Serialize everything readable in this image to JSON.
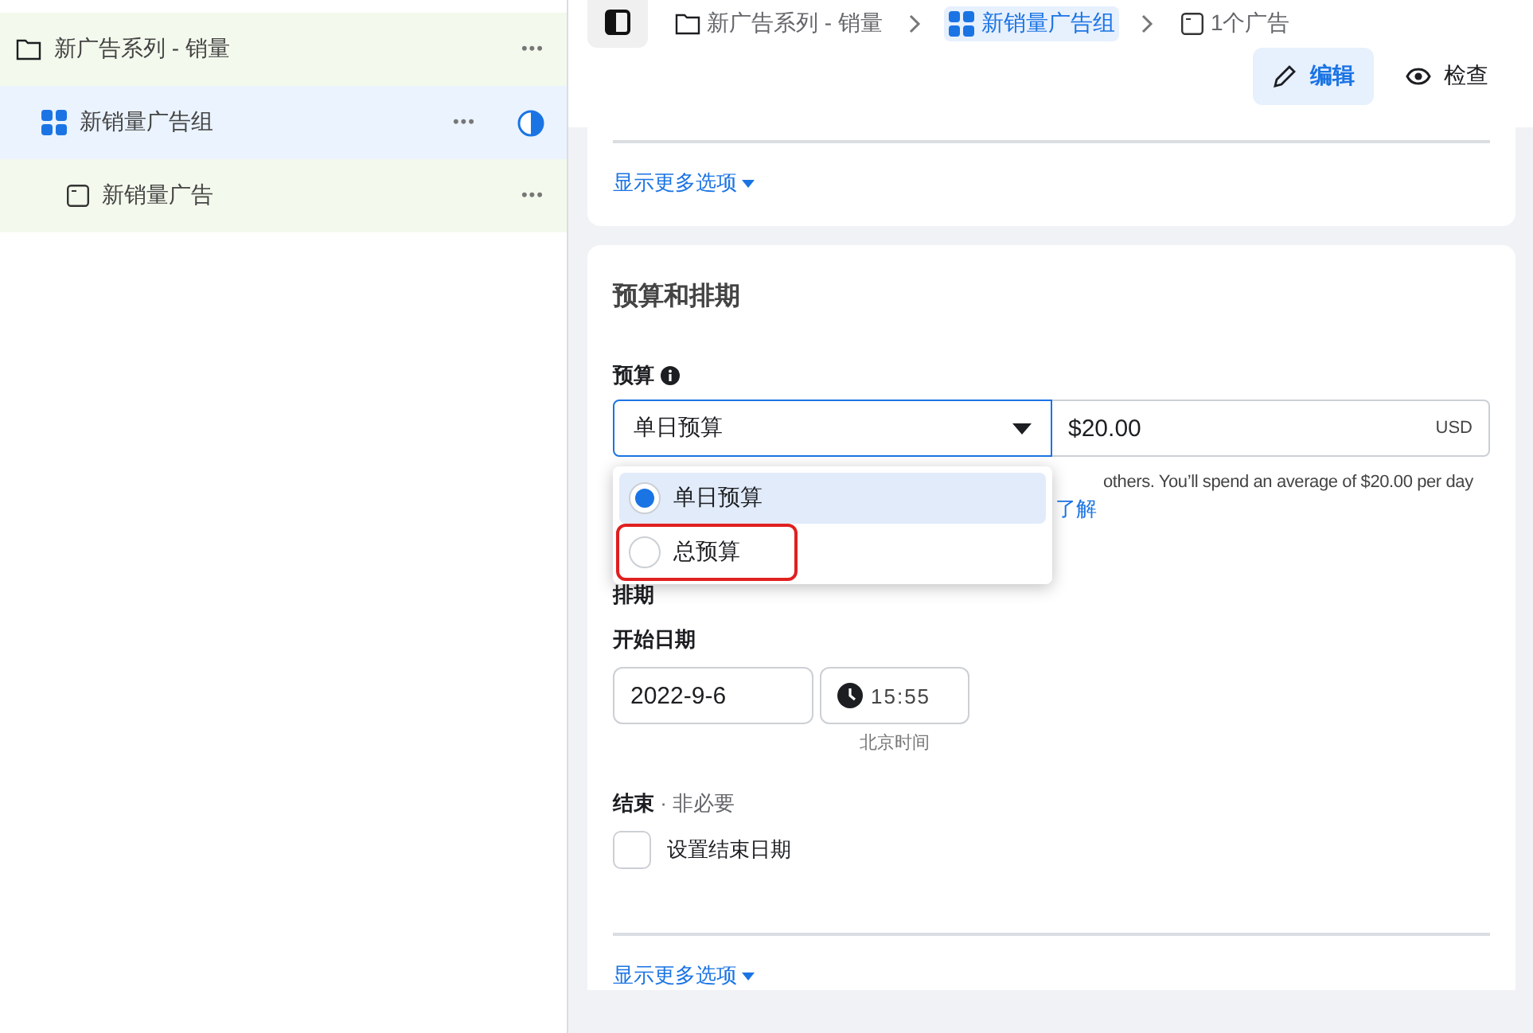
{
  "sidebar": {
    "items": [
      {
        "kind": "campaign",
        "label": "新广告系列 - 销量",
        "selected": false,
        "more": "•••",
        "status": false
      },
      {
        "kind": "adset",
        "label": "新销量广告组",
        "selected": true,
        "more": "•••",
        "status": true
      },
      {
        "kind": "ad",
        "label": "新销量广告",
        "selected": false,
        "more": "•••",
        "status": false
      }
    ]
  },
  "breadcrumb": [
    {
      "kind": "campaign",
      "label": "新广告系列 - 销量",
      "selected": false
    },
    {
      "kind": "adset",
      "label": "新销量广告组",
      "selected": true
    },
    {
      "kind": "ad",
      "label": "1个广告",
      "selected": false
    }
  ],
  "modes": [
    {
      "kind": "edit",
      "label": "编辑",
      "selected": true
    },
    {
      "kind": "view",
      "label": "检查",
      "selected": false
    }
  ],
  "top_card": {
    "more_link": "显示更多选项"
  },
  "budget_card": {
    "title": "预算和排期",
    "budget": {
      "label": "预算",
      "type_value": "单日预算",
      "amount": "$20.00",
      "currency": "USD",
      "options": [
        {
          "label": "单日预算",
          "selected": true,
          "highlighted": false
        },
        {
          "label": "总预算",
          "selected": false,
          "highlighted": true
        }
      ],
      "help_text": "others. You’ll spend an average of $20.00 per day",
      "help_link": "了解"
    },
    "schedule": {
      "label": "排期",
      "start_label": "开始日期",
      "date": "2022-9-6",
      "time": "15:55",
      "timezone": "北京时间",
      "end_label": "结束",
      "end_optional": "· 非必要",
      "end_checkbox": {
        "label": "设置结束日期",
        "checked": false
      }
    },
    "more_link": "显示更多选项"
  }
}
